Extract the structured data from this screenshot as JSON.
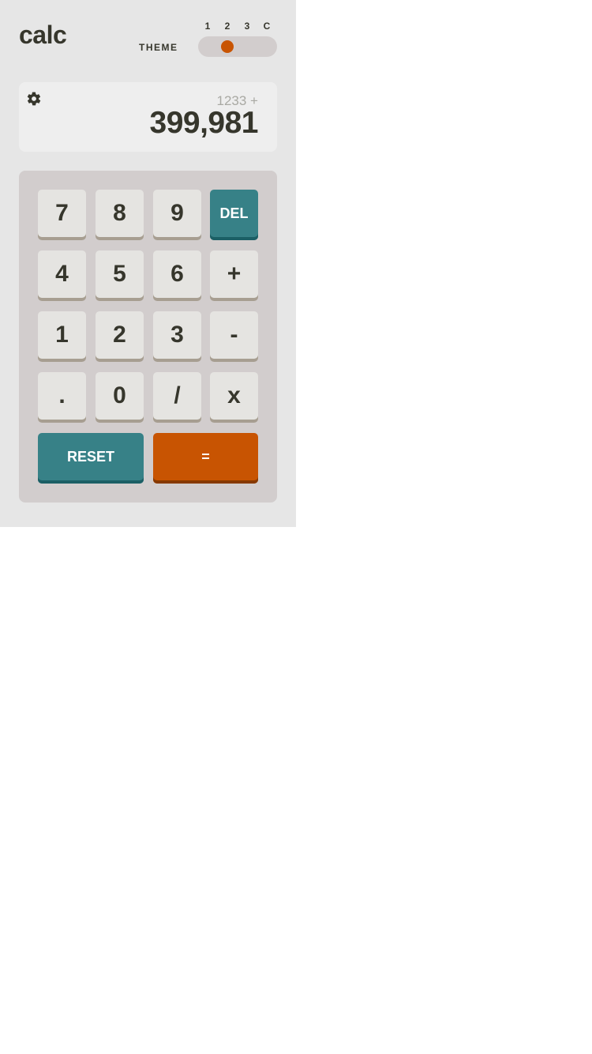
{
  "header": {
    "logo": "calc",
    "theme_label": "THEME",
    "theme_options": [
      "1",
      "2",
      "3",
      "C"
    ],
    "selected_theme": "1"
  },
  "display": {
    "expression": "1233 +",
    "value": "399,981",
    "settings_icon": "gear-icon"
  },
  "keys": {
    "k7": "7",
    "k8": "8",
    "k9": "9",
    "del": "DEL",
    "k4": "4",
    "k5": "5",
    "k6": "6",
    "plus": "+",
    "k1": "1",
    "k2": "2",
    "k3": "3",
    "minus": "-",
    "dot": ".",
    "k0": "0",
    "divide": "/",
    "multiply": "x",
    "reset": "RESET",
    "equals": "="
  },
  "colors": {
    "background": "#e6e6e6",
    "keypad": "#d2cdcd",
    "screen": "#eeeeee",
    "key": "#e5e4e1",
    "accent_teal": "#378187",
    "accent_orange": "#c85402",
    "text": "#36362c"
  }
}
